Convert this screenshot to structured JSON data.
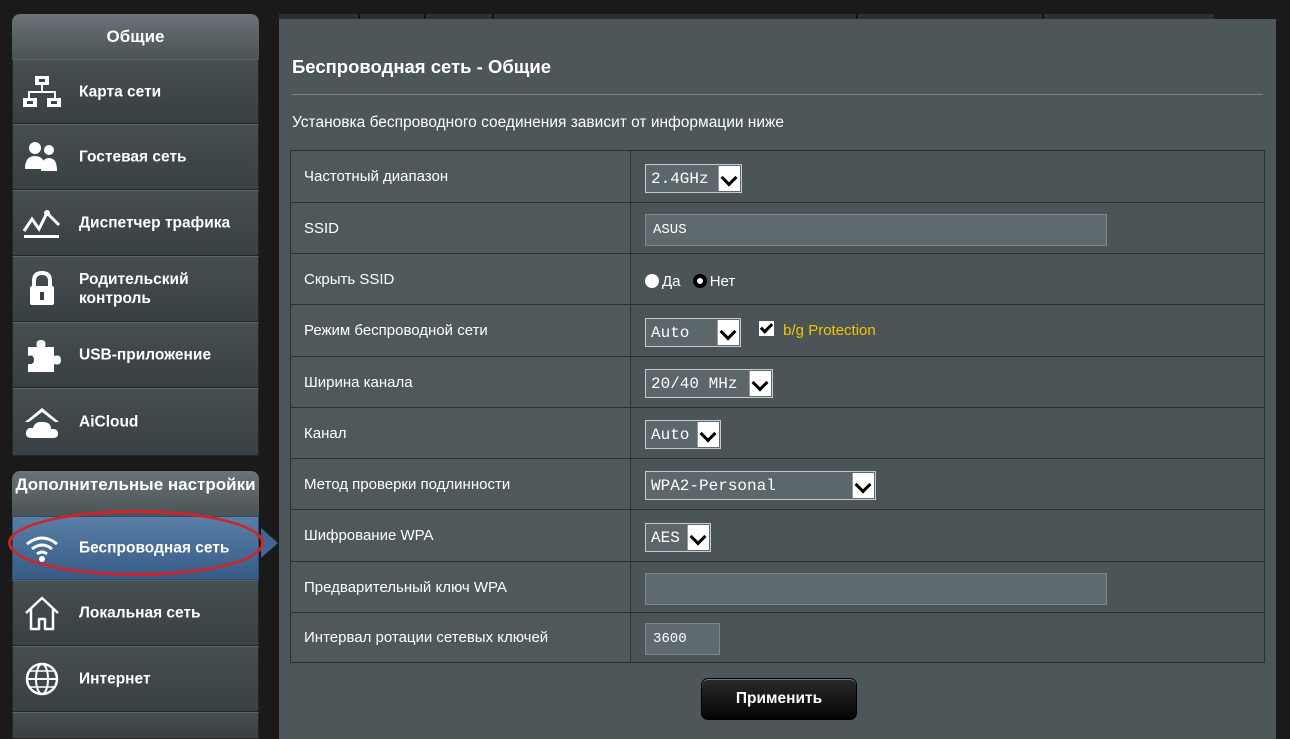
{
  "sidebar": {
    "general_header": "Общие",
    "general_items": [
      {
        "label": "Карта сети",
        "icon": "network-map-icon"
      },
      {
        "label": "Гостевая сеть",
        "icon": "guest-users-icon"
      },
      {
        "label": "Диспетчер трафика",
        "icon": "traffic-chart-icon"
      },
      {
        "label": "Родительский контроль",
        "icon": "lock-icon"
      },
      {
        "label": "USB-приложение",
        "icon": "puzzle-icon"
      },
      {
        "label": "AiCloud",
        "icon": "cloud-home-icon"
      }
    ],
    "advanced_header": "Дополнительные настройки",
    "advanced_items": [
      {
        "label": "Беспроводная сеть",
        "icon": "wifi-icon",
        "active": true
      },
      {
        "label": "Локальная сеть",
        "icon": "home-icon"
      },
      {
        "label": "Интернет",
        "icon": "globe-icon"
      }
    ]
  },
  "main": {
    "title": "Беспроводная сеть - Общие",
    "description": "Установка беспроводного соединения зависит от информации ниже",
    "fields": {
      "band_label": "Частотный диапазон",
      "band_value": "2.4GHz",
      "ssid_label": "SSID",
      "ssid_value": "ASUS",
      "hide_ssid_label": "Скрыть SSID",
      "hide_ssid_yes": "Да",
      "hide_ssid_no": "Нет",
      "hide_ssid_selected": "Нет",
      "mode_label": "Режим беспроводной сети",
      "mode_value": "Auto",
      "bg_protection_label": "b/g Protection",
      "bg_protection_checked": true,
      "width_label": "Ширина канала",
      "width_value": "20/40 MHz",
      "channel_label": "Канал",
      "channel_value": "Auto",
      "auth_label": "Метод проверки подлинности",
      "auth_value": "WPA2-Personal",
      "encryption_label": "Шифрование WPA",
      "encryption_value": "AES",
      "psk_label": "Предварительный ключ WPA",
      "psk_value": "",
      "rotation_label": "Интервал ротации сетевых ключей",
      "rotation_value": "3600"
    },
    "apply_label": "Применить"
  },
  "colors": {
    "panel_bg": "#4d5659",
    "active_item": "#3f6791",
    "highlight_ring": "#d3222a",
    "bg_protection_text": "#f5c400"
  }
}
